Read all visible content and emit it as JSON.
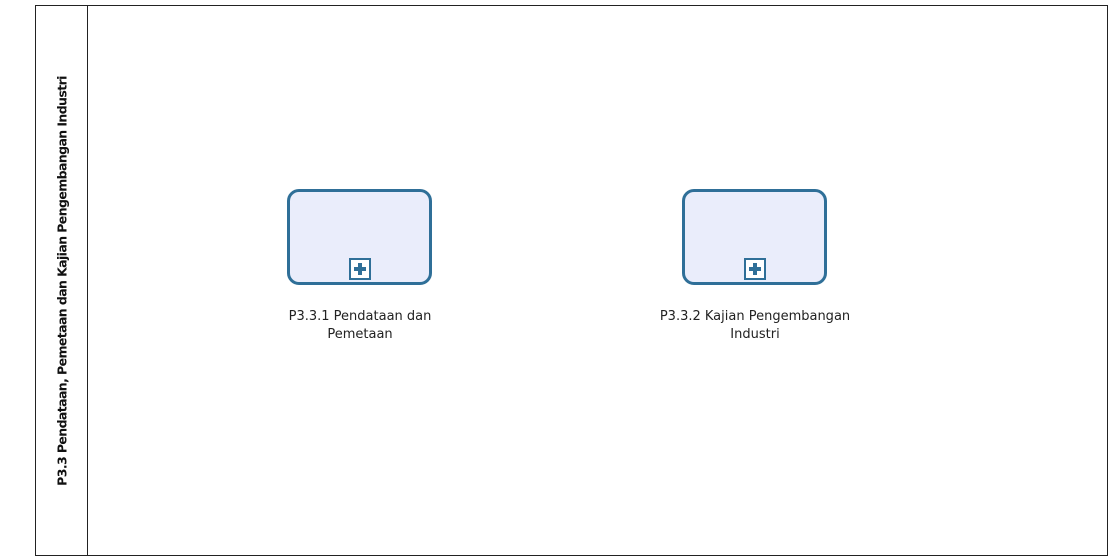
{
  "pool": {
    "lane_title": "P3.3 Pendataan, Pemetaan dan Kajian Pengembangan Industri"
  },
  "subprocesses": [
    {
      "label_line1": "P3.3.1 Pendataan dan",
      "label_line2": "Pemetaan",
      "marker_icon": "plus-icon"
    },
    {
      "label_line1": "P3.3.2 Kajian Pengembangan",
      "label_line2": "Industri",
      "marker_icon": "plus-icon"
    }
  ],
  "colors": {
    "task_border": "#2f6f98",
    "task_fill": "#eaedfb",
    "pool_border": "#222222"
  }
}
